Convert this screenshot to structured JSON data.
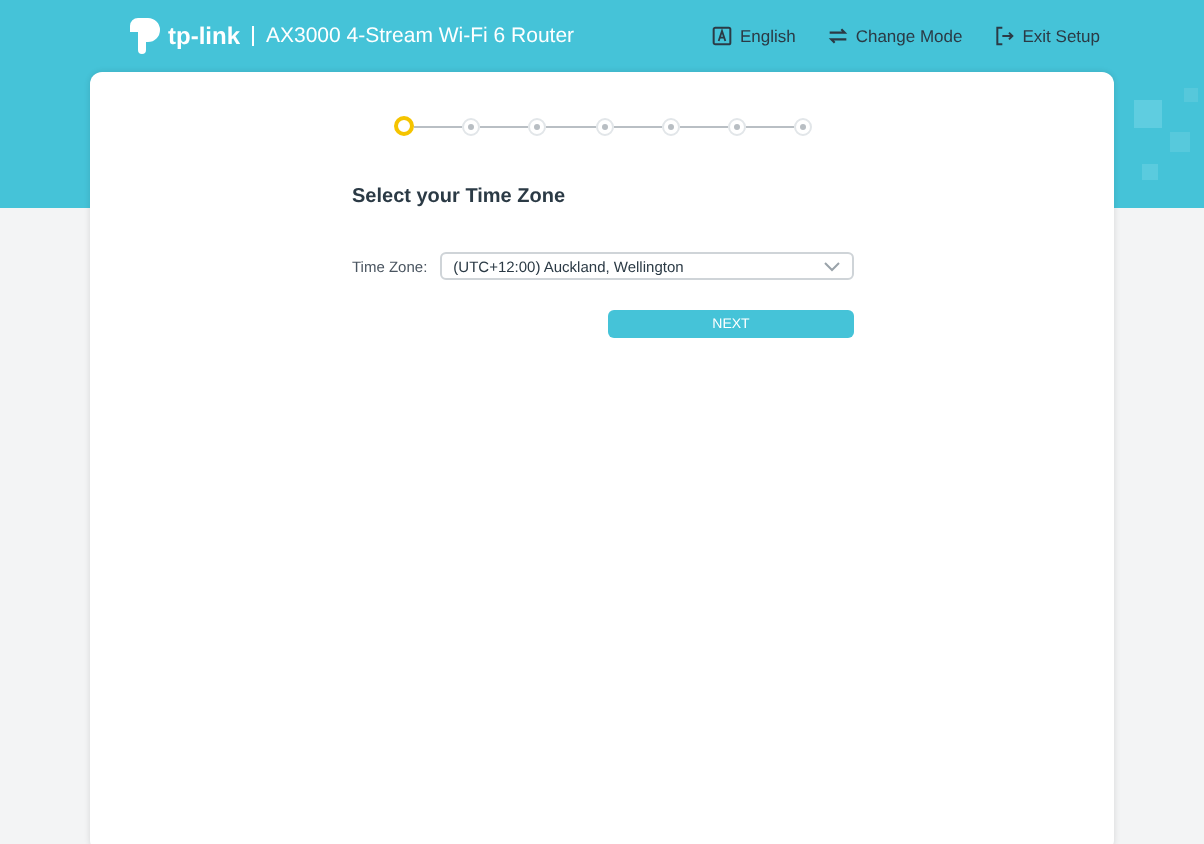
{
  "header": {
    "logo": "tp-link",
    "product": "AX3000 4-Stream Wi-Fi 6 Router",
    "actions": [
      {
        "kind": "language",
        "label": "English"
      },
      {
        "kind": "mode",
        "label": "Change Mode"
      },
      {
        "kind": "exit",
        "label": "Exit Setup"
      }
    ]
  },
  "steps": [
    {
      "selected": true
    },
    {
      "selected": false
    },
    {
      "selected": false
    },
    {
      "selected": false
    },
    {
      "selected": false
    },
    {
      "selected": false
    },
    {
      "selected": false
    }
  ],
  "title": "Select your Time Zone",
  "time_zone": {
    "label": "Time Zone:",
    "value": "(UTC+12:00) Auckland, Wellington"
  },
  "next_button": "NEXT"
}
